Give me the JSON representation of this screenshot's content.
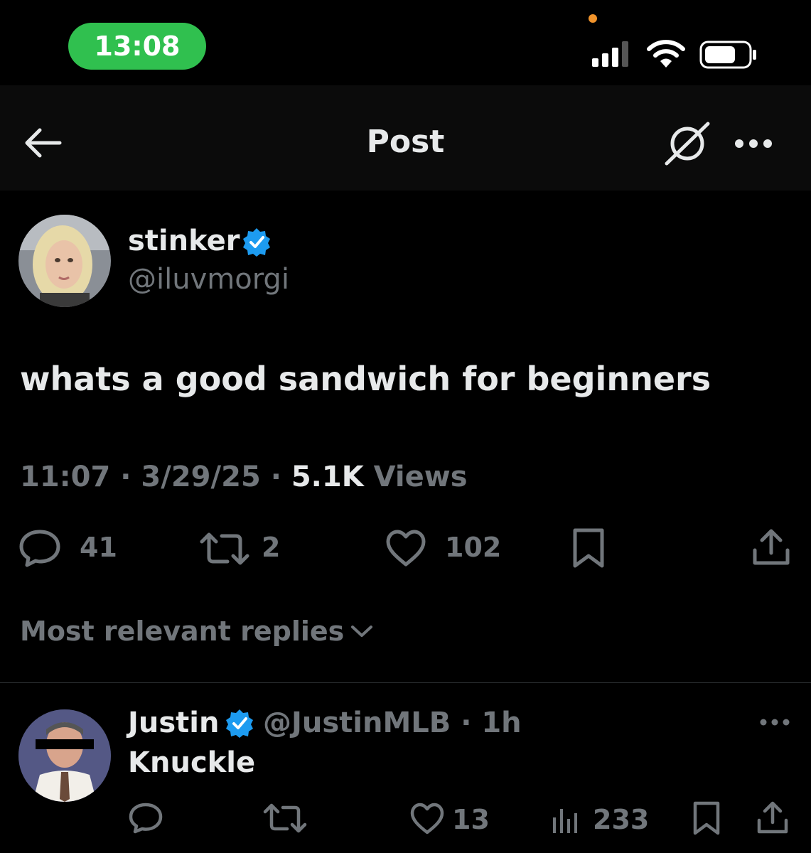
{
  "status_bar": {
    "time": "13:08"
  },
  "nav": {
    "title": "Post"
  },
  "post": {
    "author_name": "stinker",
    "author_handle": "@iluvmorgi",
    "text": "whats a good sandwich for beginners",
    "time": "11:07",
    "date": "3/29/25",
    "views_count": "5.1K",
    "views_label": "Views",
    "replies": "41",
    "reposts": "2",
    "likes": "102"
  },
  "replies_sort": {
    "label": "Most relevant replies"
  },
  "reply": {
    "author_name": "Justin",
    "author_handle": "@JustinMLB",
    "age": "1h",
    "text": "Knuckle",
    "likes": "13",
    "views": "233"
  },
  "colors": {
    "accent": "#1d9bf0",
    "background": "#000000",
    "secondary_text": "#71767b",
    "time_pill": "#30c04f"
  }
}
